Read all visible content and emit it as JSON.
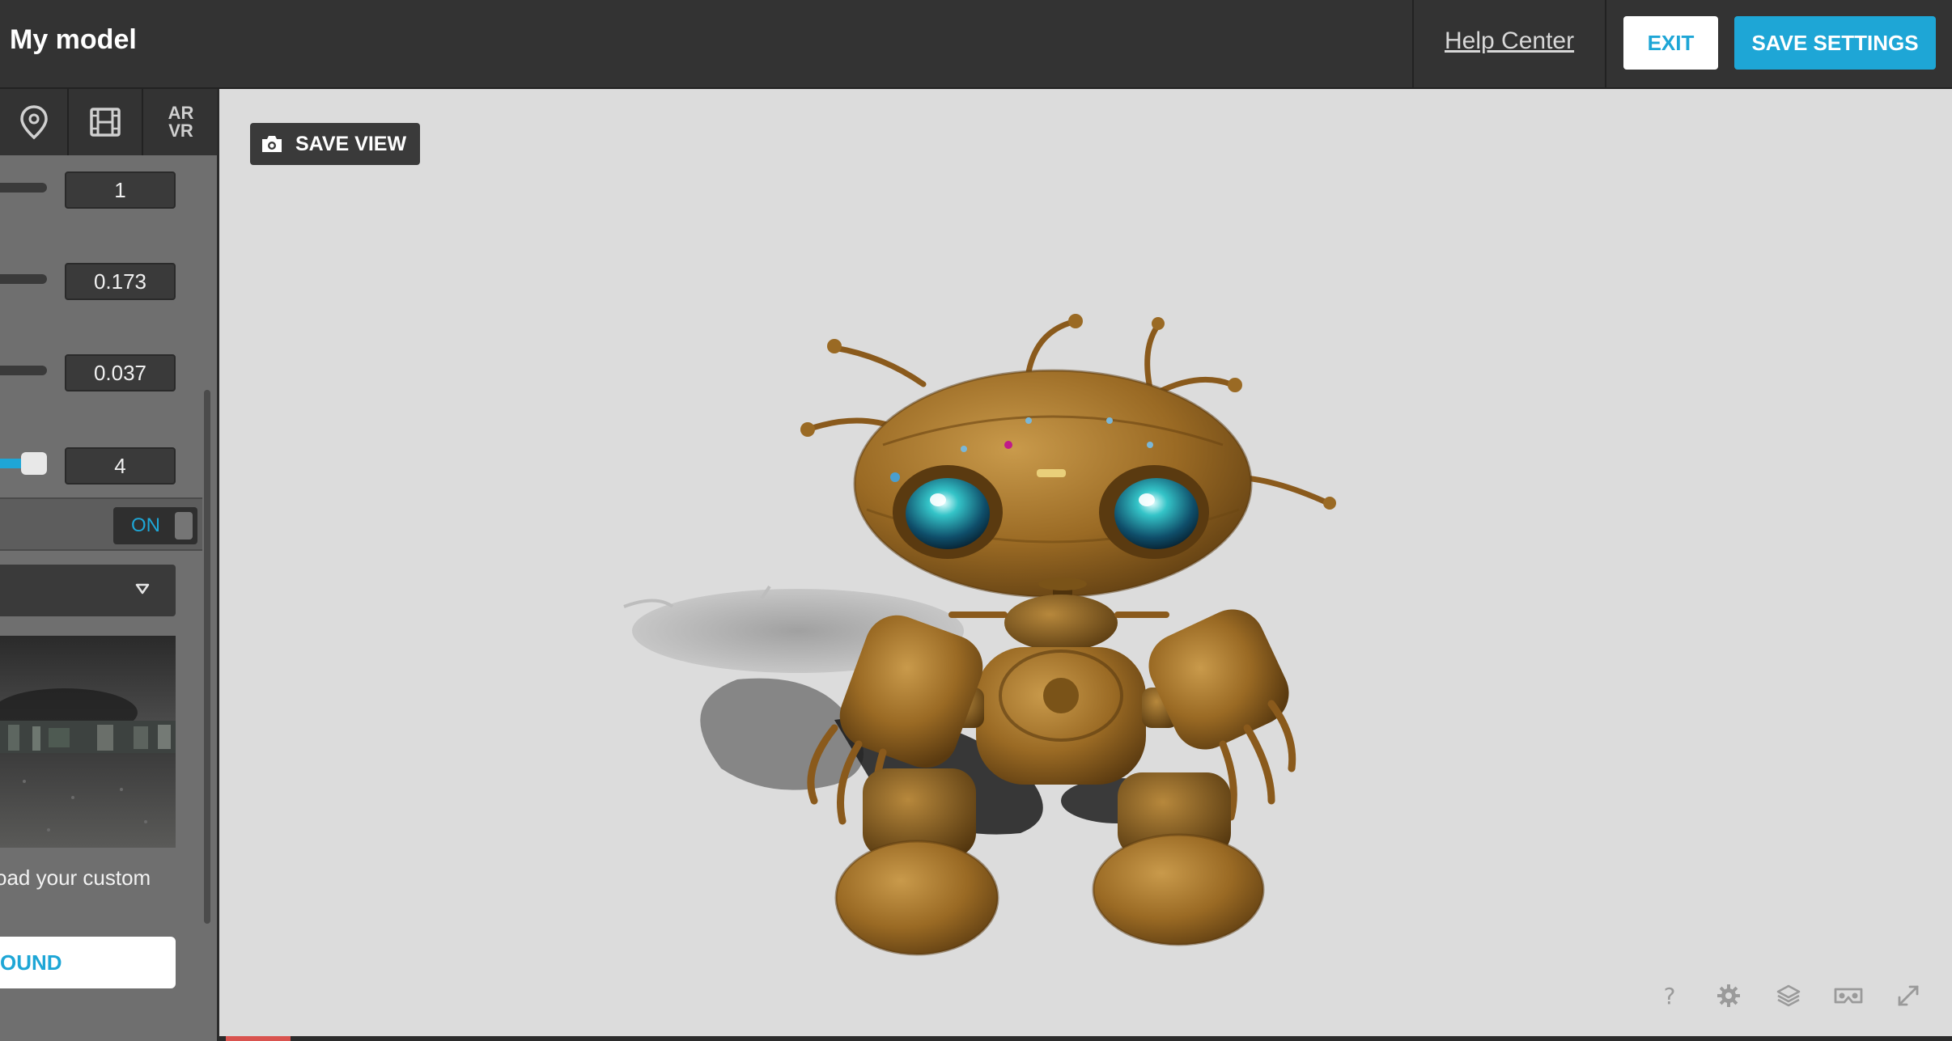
{
  "header": {
    "title": "My model",
    "help_label": "Help Center",
    "exit_label": "EXIT",
    "save_label": "SAVE SETTINGS"
  },
  "sidebar": {
    "tabs": [
      {
        "name": "pin-icon"
      },
      {
        "name": "film-icon"
      },
      {
        "name": "ar-vr-tab",
        "label_line1": "AR",
        "label_line2": "VR"
      }
    ],
    "fields": [
      {
        "value": "1"
      },
      {
        "value": "0.173"
      },
      {
        "value": "0.037"
      },
      {
        "value": "4",
        "slider_level": 0.5
      }
    ],
    "toggle_label": "ON",
    "hint": "oad your custom",
    "upload_label": "OUND"
  },
  "viewport": {
    "save_view_label": "SAVE VIEW",
    "icons": [
      "help-icon",
      "gear-icon",
      "layers-icon",
      "vr-headset-icon",
      "fullscreen-icon"
    ],
    "help_glyph": "?"
  },
  "colors": {
    "accent": "#1ea6d6",
    "topbar": "#333333",
    "sidebar": "#6f6f6f",
    "viewport_bg": "#dcdcdc",
    "model_gold": "#9a6a24"
  }
}
